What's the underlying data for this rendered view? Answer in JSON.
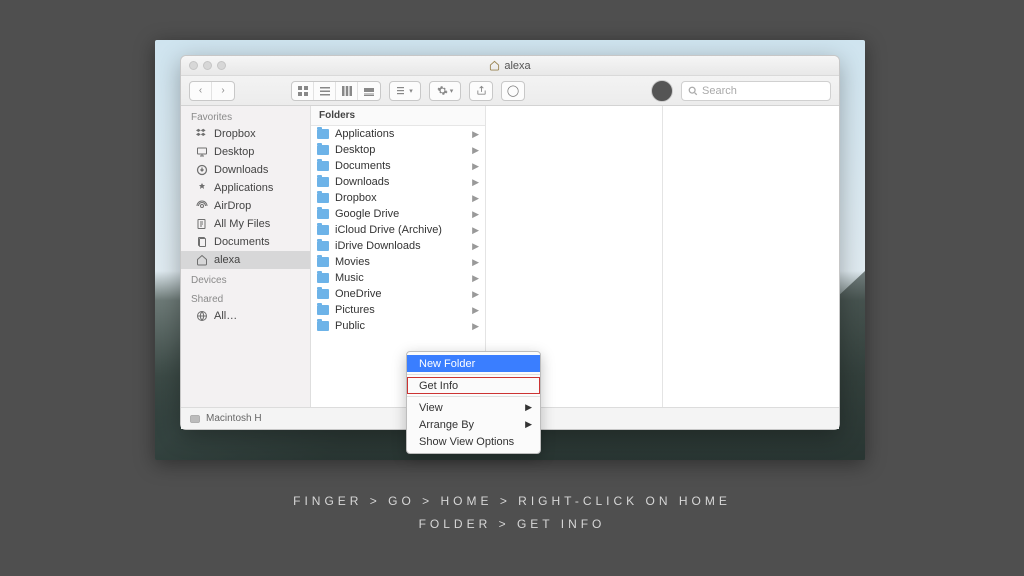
{
  "window": {
    "title": "alexa"
  },
  "toolbar": {
    "search_placeholder": "Search"
  },
  "sidebar": {
    "sections": [
      {
        "label": "Favorites",
        "items": [
          {
            "label": "Dropbox",
            "icon": "dropbox-icon"
          },
          {
            "label": "Desktop",
            "icon": "desktop-icon"
          },
          {
            "label": "Downloads",
            "icon": "downloads-icon"
          },
          {
            "label": "Applications",
            "icon": "applications-icon"
          },
          {
            "label": "AirDrop",
            "icon": "airdrop-icon"
          },
          {
            "label": "All My Files",
            "icon": "all-files-icon"
          },
          {
            "label": "Documents",
            "icon": "documents-icon"
          },
          {
            "label": "alexa",
            "icon": "home-icon",
            "selected": true
          }
        ]
      },
      {
        "label": "Devices",
        "items": []
      },
      {
        "label": "Shared",
        "items": [
          {
            "label": "All…",
            "icon": "network-icon"
          }
        ]
      }
    ]
  },
  "column": {
    "header": "Folders",
    "items": [
      "Applications",
      "Desktop",
      "Documents",
      "Downloads",
      "Dropbox",
      "Google Drive",
      "iCloud Drive (Archive)",
      "iDrive Downloads",
      "Movies",
      "Music",
      "OneDrive",
      "Pictures",
      "Public"
    ]
  },
  "pathbar": {
    "label": "Macintosh H"
  },
  "context_menu": {
    "items": [
      {
        "label": "New Folder",
        "highlight": true
      },
      {
        "label": "",
        "sep": true
      },
      {
        "label": "Get Info",
        "boxed": true
      },
      {
        "label": "",
        "sep": true
      },
      {
        "label": "View",
        "submenu": true
      },
      {
        "label": "Arrange By",
        "submenu": true
      },
      {
        "label": "Show View Options"
      }
    ]
  },
  "caption": {
    "line1": "FINGER > GO > HOME > RIGHT-CLICK ON HOME",
    "line2": "FOLDER > GET INFO"
  }
}
